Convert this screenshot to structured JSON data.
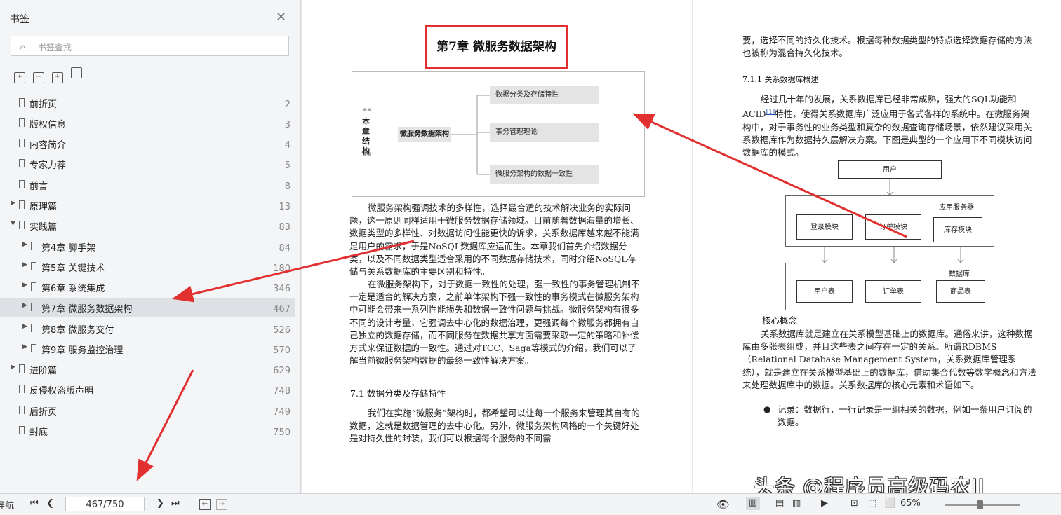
{
  "sidebar": {
    "title": "书签",
    "search_placeholder": "书签查找",
    "items": [
      {
        "label": "前折页",
        "page": "2"
      },
      {
        "label": "版权信息",
        "page": "3"
      },
      {
        "label": "内容简介",
        "page": "4"
      },
      {
        "label": "专家力荐",
        "page": "5"
      },
      {
        "label": "前言",
        "page": "8"
      },
      {
        "label": "原理篇",
        "page": "13"
      },
      {
        "label": "实践篇",
        "page": "83"
      },
      {
        "label": "第4章 脚手架",
        "page": "84"
      },
      {
        "label": "第5章 关键技术",
        "page": "180"
      },
      {
        "label": "第6章 系统集成",
        "page": "346"
      },
      {
        "label": "第7章 微服务数据架构",
        "page": "467"
      },
      {
        "label": "第8章 微服务交付",
        "page": "526"
      },
      {
        "label": "第9章 服务监控治理",
        "page": "570"
      },
      {
        "label": "进阶篇",
        "page": "629"
      },
      {
        "label": "反侵权盗版声明",
        "page": "748"
      },
      {
        "label": "后折页",
        "page": "749"
      },
      {
        "label": "封底",
        "page": "750"
      }
    ]
  },
  "left_page": {
    "chapter_title": "第7章  微服务数据架构",
    "diagram": {
      "side_label": "本章结构",
      "center": "微服务数据架构",
      "branches": [
        "数据分类及存储特性",
        "事务管理理论",
        "微服务架构的数据一致性"
      ]
    },
    "paragraphs": [
      "微服务架构强调技术的多样性，选择最合适的技术解决业务的实际问题，这一原则同样适用于微服务数据存储领域。目前随着数据海量的增长、数据类型的多样性、对数据访问性能更快的诉求，关系数据库越来越不能满足用户的需求，于是NoSQL数据库应运而生。本章我们首先介绍数据分类，以及不同数据类型适合采用的不同数据存储技术，同时介绍NoSQL存储与关系数据库的主要区别和特性。",
      "在微服务架构下，对于数据一致性的处理，强一致性的事务管理机制不一定是适合的解决方案，之前单体架构下强一致性的事务模式在微服务架构中可能会带来一系列性能损失和数据一致性问题与挑战。微服务架构有很多不同的设计考量，它强调去中心化的数据治理，更强调每个微服务都拥有自己独立的数据存储，而不同服务在数据共享方面需要采取一定的策略和补偿方式来保证数据的一致性。通过对TCC、Saga等模式的介绍，我们可以了解当前微服务架构数据的最终一致性解决方案。"
    ],
    "section_heading": "7.1  数据分类及存储特性",
    "section_para": "我们在实施“微服务”架构时，都希望可以让每一个服务来管理其自有的数据，这就是数据管理的去中心化。另外，微服务架构风格的一个关键好处是对持久性的封装，我们可以根据每个服务的不同需"
  },
  "right_page": {
    "top_para": "要，选择不同的持久化技术。根据每种数据类型的特点选择数据存储的方法也被称为混合持久化技术。",
    "subheading": "7.1.1  关系数据库概述",
    "para1_a": "经过几十年的发展，关系数据库已经非常成熟，强大的SQL功能和ACID",
    "para1_ref": "[1]",
    "para1_b": "特性，使得关系数据库广泛应用于各式各样的系统中。在微服务架构中，对于事务性的业务类型和复杂的数据查询存储场景，依然建议采用关系数据库作为数据持久层解决方案。下图是典型的一个应用下不同模块访问数据库的模式。",
    "arch": {
      "user": "用户",
      "app_server": "应用服务器",
      "modules": [
        "登录模块",
        "订单模块",
        "库存模块"
      ],
      "db": "数据库",
      "tables": [
        "用户表",
        "订单表",
        "商品表"
      ]
    },
    "core_heading": "核心概念",
    "para2": "关系数据库就是建立在关系模型基础上的数据库。通俗来讲，这种数据库由多张表组成，并且这些表之间存在一定的关系。所谓RDBMS（Relational Database Management System，关系数据库管理系统），就是建立在关系模型基础上的数据库，借助集合代数等数学概念和方法来处理数据库中的数据。关系数据库的核心元素和术语如下。",
    "bullet": "记录：数据行，一行记录是一组相关的数据，例如一条用户订阅的数据。"
  },
  "statusbar": {
    "nav_label": "导航",
    "page_input": "467/750",
    "zoom": "65%"
  },
  "watermark": "头条 @程序员高级码农II",
  "accent_red": "#e23030"
}
